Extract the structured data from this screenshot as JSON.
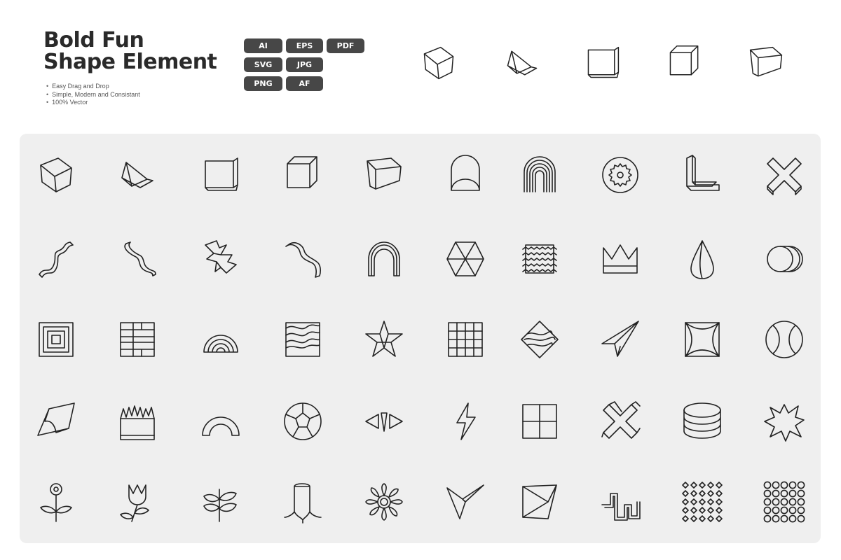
{
  "header": {
    "title_line1": "Bold Fun",
    "title_line2": "Shape Element",
    "features": [
      "Easy Drag and Drop",
      "Simple, Modern and Consistant",
      "100% Vector"
    ]
  },
  "formats": [
    "AI",
    "EPS",
    "PDF",
    "SVG",
    "JPG",
    "PNG",
    "AF"
  ],
  "colors": {
    "panel": "#efefef",
    "badge": "#474747",
    "stroke": "#222222",
    "text": "#2a2a2a"
  },
  "preview_icons": [
    "cube-icon",
    "prism-icon",
    "square-box-icon",
    "box-icon",
    "wedge-box-icon"
  ],
  "grid_icons": [
    [
      "cube-icon",
      "prism-icon",
      "square-box-icon",
      "box-icon",
      "wedge-box-icon",
      "arch-door-icon",
      "rainbow-arch-icon",
      "gear-circle-icon",
      "l-shape-icon",
      "x-block-icon"
    ],
    [
      "squiggle-icon",
      "twisted-ribbon-icon",
      "zigzag-3d-icon",
      "ribbon-icon",
      "arch-3d-icon",
      "hexagon-icon",
      "wavy-square-icon",
      "crown-icon",
      "drop-icon",
      "cylinder-icon"
    ],
    [
      "nested-squares-icon",
      "brick-grid-icon",
      "half-rainbow-icon",
      "wave-box-icon",
      "star-icon",
      "grid-icon",
      "wave-diamond-icon",
      "paper-plane-icon",
      "hourglass-square-icon",
      "tennis-ball-icon"
    ],
    [
      "folded-diamond-icon",
      "grass-box-icon",
      "arch-icon",
      "soccer-ball-icon",
      "sparkle-fan-icon",
      "lightning-icon",
      "window-icon",
      "double-x-icon",
      "stacked-discs-icon",
      "burst-icon"
    ],
    [
      "flower-icon",
      "tulip-icon",
      "leaf-branch-icon",
      "tree-stump-icon",
      "daisy-icon",
      "arrow-cursor-icon",
      "folded-plane-icon",
      "zigzag-line-icon",
      "diamond-pattern-icon",
      "circle-pattern-icon"
    ]
  ]
}
